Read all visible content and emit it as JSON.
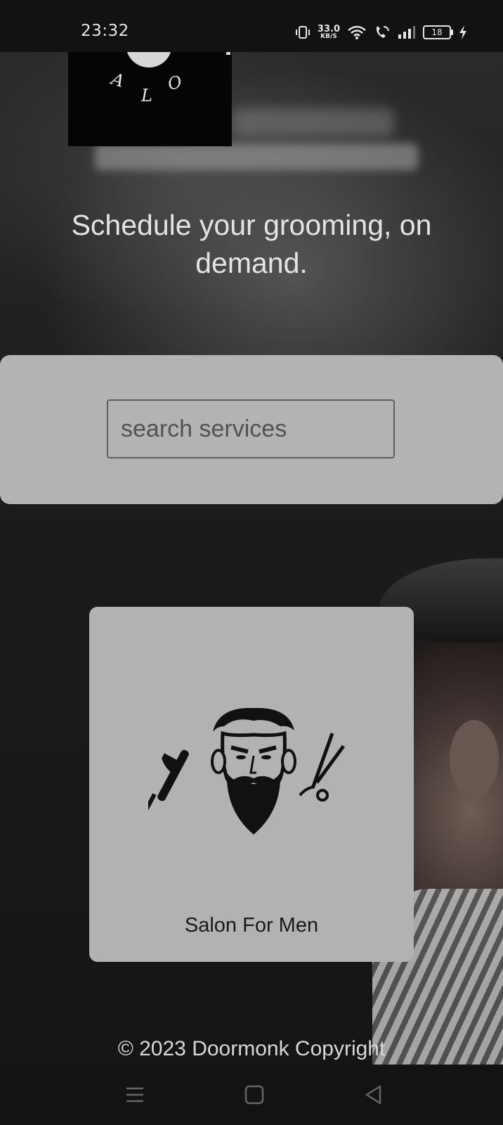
{
  "status_bar": {
    "time": "23:32",
    "network_speed_value": "33.0",
    "network_speed_unit": "KB/S",
    "battery_level": "18",
    "icons": [
      "vibrate-icon",
      "wifi-icon",
      "wifi-call-icon",
      "signal-icon",
      "battery-icon",
      "charging-icon"
    ]
  },
  "logo": {
    "letters": [
      "A",
      "L",
      "O"
    ]
  },
  "hero": {
    "headline": "Schedule your grooming, on demand."
  },
  "search": {
    "placeholder": "search services"
  },
  "services": [
    {
      "label": "Salon For Men",
      "icon": "bearded-man-scissors-razor-icon"
    }
  ],
  "footer": {
    "text": "© 2023 Doormonk Copyright"
  },
  "nav_bar": {
    "icons": [
      "menu-icon",
      "home-icon",
      "back-icon"
    ]
  },
  "colors": {
    "panel": "#b3b3b3",
    "status_bar": "#141111",
    "headline": "#e4e4e4"
  }
}
